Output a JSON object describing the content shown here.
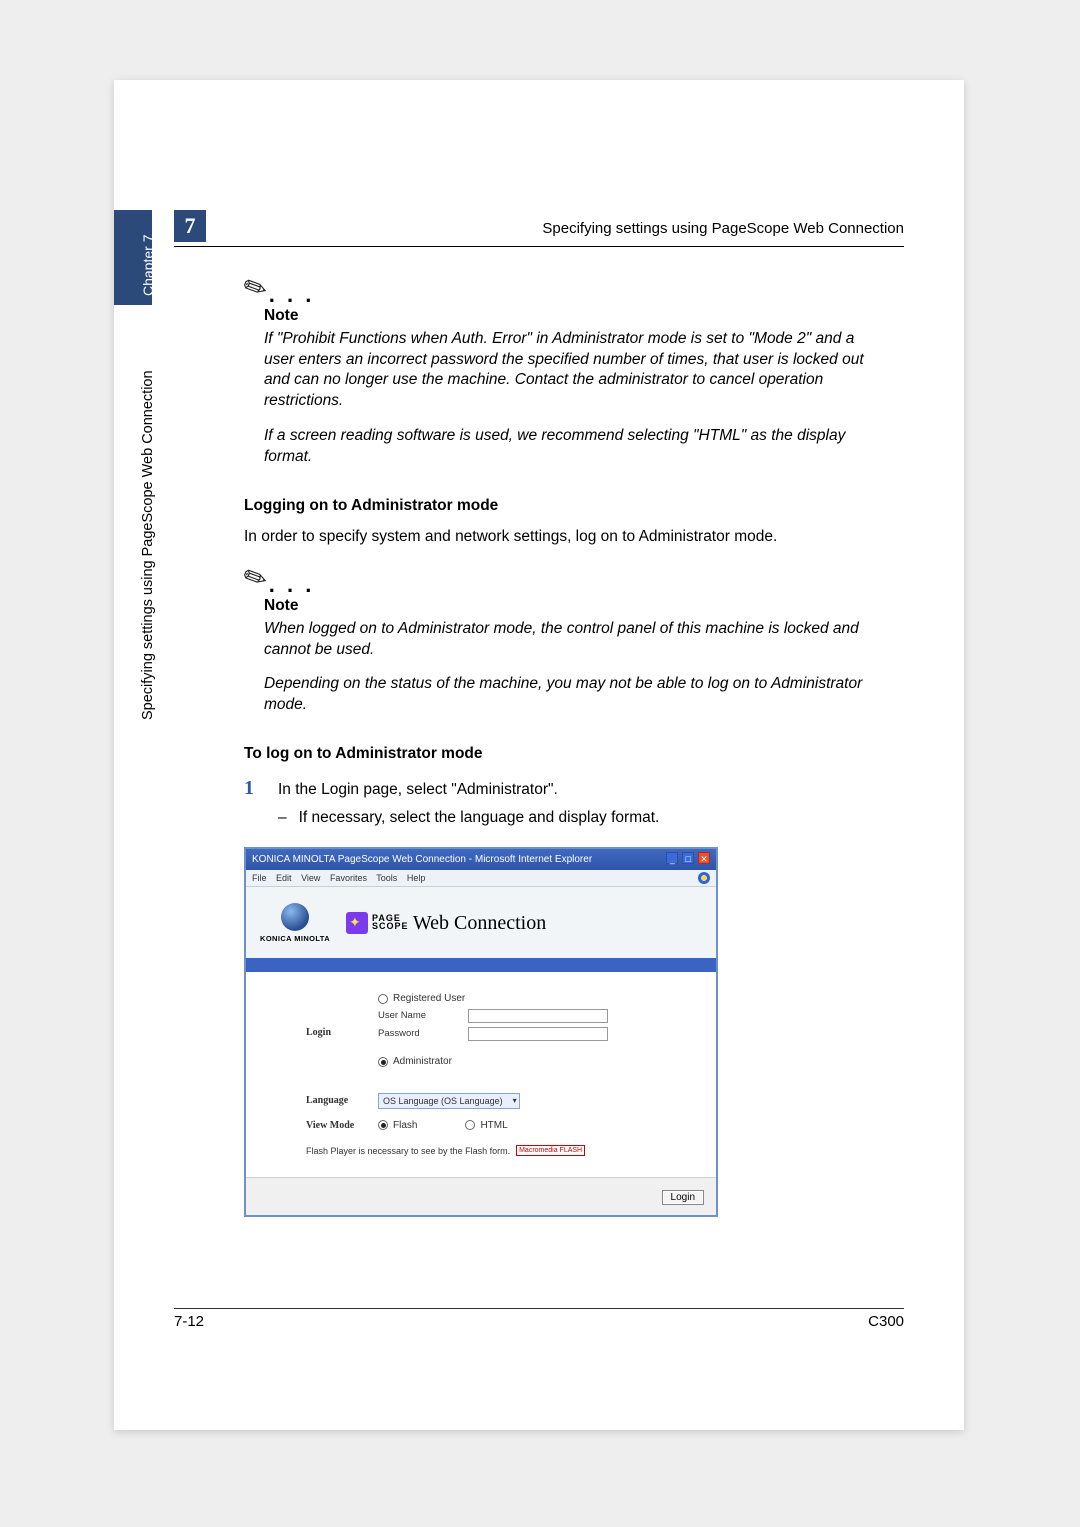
{
  "chapter": {
    "number": "7",
    "tabLabel": "Chapter 7",
    "sideTitle": "Specifying settings using PageScope Web Connection"
  },
  "header": {
    "title": "Specifying settings using PageScope Web Connection"
  },
  "note1": {
    "icon": "✎",
    "dots": ". . .",
    "heading": "Note",
    "para1": "If \"Prohibit Functions when Auth. Error\" in Administrator mode is set to \"Mode 2\" and a user enters an incorrect password the specified number of times, that user is locked out and can no longer use the machine. Contact the administrator to cancel operation restrictions.",
    "para2": "If a screen reading software is used, we recommend selecting \"HTML\" as the display format."
  },
  "section1": {
    "heading": "Logging on to Administrator mode",
    "body": "In order to specify system and network settings, log on to Administrator mode."
  },
  "note2": {
    "icon": "✎",
    "dots": ". . .",
    "heading": "Note",
    "para1": "When logged on to Administrator mode, the control panel of this machine is locked and cannot be used.",
    "para2": "Depending on the status of the machine, you may not be able to log on to Administrator mode."
  },
  "section2": {
    "heading": "To log on to Administrator mode",
    "step1": {
      "num": "1",
      "text": "In the Login page, select \"Administrator\"."
    },
    "sub1": "If necessary, select the language and display format."
  },
  "screenshot": {
    "titlebar": "KONICA MINOLTA PageScope Web Connection - Microsoft Internet Explorer",
    "menus": [
      "File",
      "Edit",
      "View",
      "Favorites",
      "Tools",
      "Help"
    ],
    "kmName": "KONICA MINOLTA",
    "psPage": "PAGE",
    "psScope": "SCOPE",
    "psWeb": "Web Connection",
    "labels": {
      "login": "Login",
      "registeredUser": "Registered User",
      "userName": "User Name",
      "password": "Password",
      "administrator": "Administrator",
      "language": "Language",
      "languageValue": "OS Language (OS Language)",
      "viewMode": "View Mode",
      "flash": "Flash",
      "html": "HTML",
      "flashNote": "Flash Player is necessary to see by the Flash form.",
      "flashBadge": "Macromedia\nFLASH",
      "loginBtn": "Login"
    }
  },
  "footer": {
    "pageNum": "7-12",
    "model": "C300"
  }
}
